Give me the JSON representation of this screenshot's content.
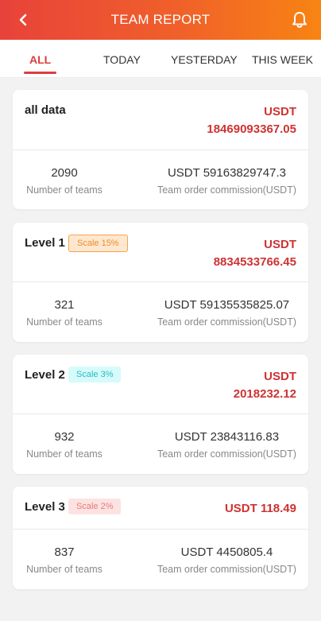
{
  "header": {
    "title": "TEAM REPORT",
    "back_icon": "chevron-left-icon",
    "notification_icon": "bell-icon",
    "gradient_start": "#e8423a",
    "gradient_end": "#f88412"
  },
  "tabs": [
    {
      "label": "ALL",
      "active": true
    },
    {
      "label": "TODAY",
      "active": false
    },
    {
      "label": "YESTERDAY",
      "active": false
    },
    {
      "label": "THIS WEEK",
      "active": false
    }
  ],
  "accent_color": "#e03c3c",
  "cards": [
    {
      "title": "all data",
      "badge": null,
      "currency": "USDT",
      "amount": "18469093367.05",
      "teams_value": "2090",
      "teams_label": "Number of teams",
      "commission_value": "USDT 59163829747.3",
      "commission_label": "Team order commission(USDT)"
    },
    {
      "title": "Level 1",
      "badge": "Scale 15%",
      "currency": "USDT",
      "amount": "8834533766.45",
      "teams_value": "321",
      "teams_label": "Number of teams",
      "commission_value": "USDT 59135535825.07",
      "commission_label": "Team order commission(USDT)"
    },
    {
      "title": "Level 2",
      "badge": "Scale 3%",
      "currency": "USDT",
      "amount": "2018232.12",
      "teams_value": "932",
      "teams_label": "Number of teams",
      "commission_value": "USDT 23843116.83",
      "commission_label": "Team order commission(USDT)"
    },
    {
      "title": "Level 3",
      "badge": "Scale 2%",
      "amount_full": "USDT 118.49",
      "teams_value": "837",
      "teams_label": "Number of teams",
      "commission_value": "USDT 4450805.4",
      "commission_label": "Team order commission(USDT)"
    }
  ]
}
